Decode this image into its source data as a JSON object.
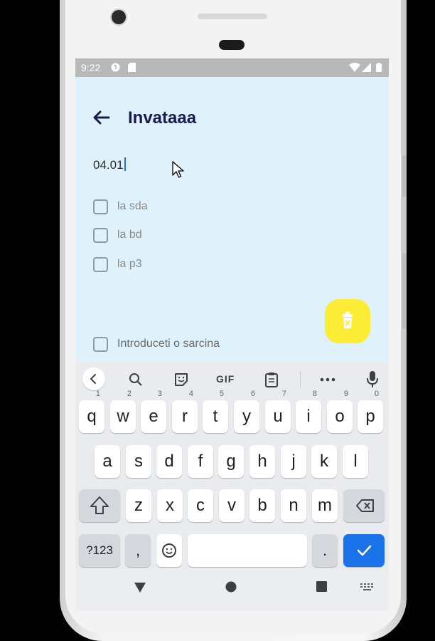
{
  "status_bar": {
    "time": "9:22",
    "icons": [
      "game-icon",
      "sd-card-icon",
      "wifi-icon",
      "signal-icon",
      "battery-icon"
    ]
  },
  "app": {
    "title": "Invataaa",
    "date_value": "04.01",
    "tasks": [
      {
        "label": "la sda",
        "checked": false
      },
      {
        "label": "la bd",
        "checked": false
      },
      {
        "label": "la p3",
        "checked": false
      }
    ],
    "new_task_placeholder": "Introduceti o sarcina",
    "fab_icon": "delete-icon",
    "colors": {
      "background": "#dff2fc",
      "title": "#1a1a4e",
      "fab": "#fcec36"
    }
  },
  "keyboard": {
    "toolbar": {
      "gif_label": "GIF",
      "items": [
        "back-icon",
        "search-icon",
        "sticker-icon",
        "gif",
        "clipboard-icon",
        "more-icon",
        "mic-icon"
      ]
    },
    "rows": [
      [
        {
          "k": "q",
          "h": "1"
        },
        {
          "k": "w",
          "h": "2"
        },
        {
          "k": "e",
          "h": "3"
        },
        {
          "k": "r",
          "h": "4"
        },
        {
          "k": "t",
          "h": "5"
        },
        {
          "k": "y",
          "h": "6"
        },
        {
          "k": "u",
          "h": "7"
        },
        {
          "k": "i",
          "h": "8"
        },
        {
          "k": "o",
          "h": "9"
        },
        {
          "k": "p",
          "h": "0"
        }
      ],
      [
        {
          "k": "a"
        },
        {
          "k": "s"
        },
        {
          "k": "d"
        },
        {
          "k": "f"
        },
        {
          "k": "g"
        },
        {
          "k": "h"
        },
        {
          "k": "j"
        },
        {
          "k": "k"
        },
        {
          "k": "l"
        }
      ],
      [
        {
          "k": "z"
        },
        {
          "k": "x"
        },
        {
          "k": "c"
        },
        {
          "k": "v"
        },
        {
          "k": "b"
        },
        {
          "k": "n"
        },
        {
          "k": "m"
        }
      ]
    ],
    "symbols_label": "?123",
    "comma_label": ",",
    "period_label": ".",
    "colors": {
      "enter": "#1a73e8"
    }
  },
  "nav_bar": {
    "icons": [
      "back-triangle-icon",
      "home-circle-icon",
      "recents-square-icon",
      "keyboard-switch-icon"
    ]
  }
}
